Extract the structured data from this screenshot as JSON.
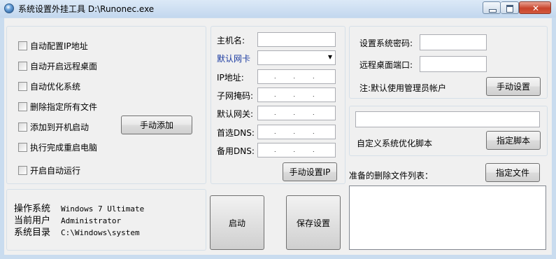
{
  "window": {
    "title": "系统设置外挂工具 D:\\Runonec.exe",
    "close_glyph": "✕"
  },
  "options": [
    {
      "label": "自动配置IP地址"
    },
    {
      "label": "自动开启远程桌面"
    },
    {
      "label": "自动优化系统"
    },
    {
      "label": "删除指定所有文件"
    },
    {
      "label": "添加到开机启动"
    },
    {
      "label": "执行完成重启电脑"
    }
  ],
  "auto_run_label": "开启自动运行",
  "manual_add_label": "手动添加",
  "network": {
    "hostname_label": "主机名:",
    "hostname_value": "",
    "adapter_label": "默认网卡",
    "adapter_value": "",
    "ip_label": "IP地址:",
    "subnet_label": "子网掩码:",
    "gateway_label": "默认网关:",
    "dns1_label": "首选DNS:",
    "dns2_label": "备用DNS:",
    "ip_dot": ".",
    "manual_ip_label": "手动设置IP"
  },
  "remote": {
    "password_label": "设置系统密码:",
    "password_value": "",
    "port_label": "远程桌面端口:",
    "port_value": "",
    "note": "注:默认使用管理员帐户",
    "manual_settings_label": "手动设置"
  },
  "script": {
    "path_value": "",
    "caption": "自定义系统优化脚本",
    "choose_label": "指定脚本"
  },
  "files": {
    "list_label": "准备的删除文件列表：",
    "choose_label": "指定文件",
    "items": []
  },
  "sysinfo": {
    "os_label": "操作系统",
    "os_value": "Windows 7 Ultimate",
    "user_label": "当前用户",
    "user_value": "Administrator",
    "dir_label": "系统目录",
    "dir_value": "C:\\Windows\\system"
  },
  "actions": {
    "start_label": "启动",
    "save_label": "保存设置"
  },
  "colors": {
    "adapter_label": "#1a3aa0",
    "titlebar_top": "#dce9f7",
    "close_button": "#c8442c"
  },
  "icons": {
    "dropdown": "▾"
  }
}
